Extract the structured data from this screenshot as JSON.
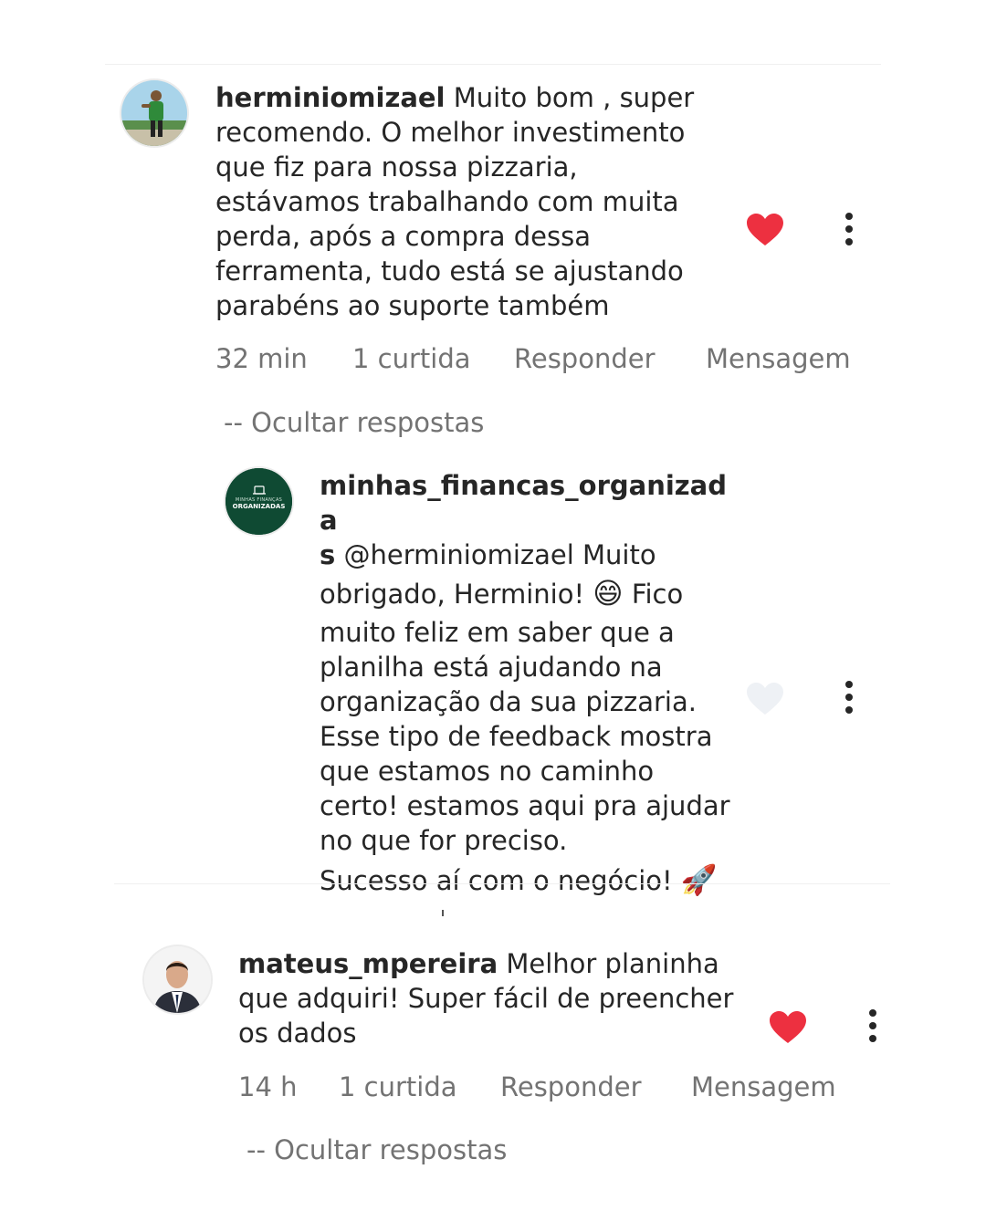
{
  "comments": [
    {
      "username": "herminiomizael",
      "text": "Muito bom , super recomendo. O melhor investimento que fiz para nossa pizzaria, estávamos trabalhando com muita perda, após a compra dessa ferramenta, tudo está se ajustando parabéns ao suporte também",
      "time": "32 min",
      "likes": "1 curtida",
      "reply_label": "Responder",
      "message_label": "Mensagem",
      "hide_replies": "-- Ocultar respostas",
      "liked": true,
      "reply": {
        "username_line1": "minhas_financas_organizada",
        "username_line2": "s",
        "mention": "@herminiomizael",
        "line_a": "Muito",
        "line_b_pre": "obrigado, Herminio!",
        "emoji_smile": "😄",
        "line_b_post": "Fico",
        "body": "muito feliz em saber que a planilha está ajudando na organização da sua pizzaria. Esse tipo de feedback mostra que estamos no caminho certo! estamos aqui pra ajudar no que for preciso.",
        "closing": "Sucesso aí com o negócio!",
        "emoji_rocket": "🚀",
        "avatar_text_top": "MINHAS FINANÇAS",
        "avatar_text_bottom": "ORGANIZADAS",
        "liked": false
      }
    },
    {
      "username": "mateus_mpereira",
      "text": "Melhor planinha que adquiri! Super fácil de preencher os dados",
      "time": "14 h",
      "likes": "1 curtida",
      "reply_label": "Responder",
      "message_label": "Mensagem",
      "hide_replies": "-- Ocultar respostas",
      "liked": true
    }
  ],
  "colors": {
    "heart_liked": "#ed3040",
    "heart_unliked": "#eef1f5",
    "brand_green": "#0f4a33",
    "muted": "#737373",
    "text": "#262626"
  }
}
